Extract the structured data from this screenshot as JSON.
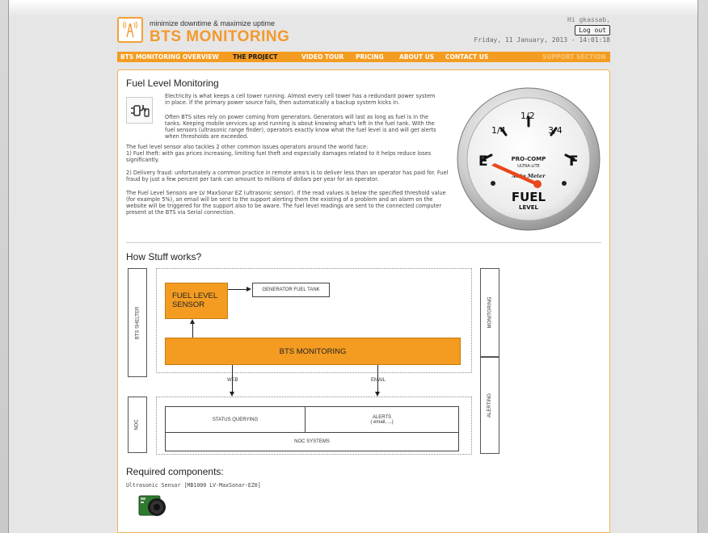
{
  "header": {
    "tagline": "minimize downtime & maximize uptime",
    "brand": "BTS MONITORING",
    "greeting": "Hi gkassab,",
    "logout_label": "Log out",
    "datetime": "Friday, 11 January, 2013 - 14:01:18"
  },
  "nav": {
    "items": [
      {
        "label": "BTS MONITORING OVERVIEW"
      },
      {
        "label": "THE PROJECT"
      },
      {
        "label": "VIDEO TOUR"
      },
      {
        "label": "PRICING"
      },
      {
        "label": "ABOUT US"
      },
      {
        "label": "CONTACT US"
      },
      {
        "label": "SUPPORT SECTION"
      }
    ]
  },
  "fuel": {
    "title": "Fuel Level Monitoring",
    "p1": "Electricity is what keeps a cell tower running. Almost every cell tower has a redundant power system in place. If the primary power source fails, then automatically a backup system kicks in.",
    "p2": "Often BTS sites rely on power coming from generators. Generators will last as long as fuel is in the tanks. Keeping mobile services up and running is about knowing what's left in the fuel tank. With the fuel sensors (ultrasonic range finder), operators exactly know what the fuel level is and will get alerts when thresholds are exceeded.",
    "p3a": "The fuel level sensor also tackles 2 other common issues operators around the world face:",
    "p3b": "1) Fuel theft: with gas prices increasing, limiting fuel theft and especially damages related to it helps reduce loses significantly.",
    "p4": "2) Delivery fraud: unfortunately a common practice in remote area's is to deliver less than an operator has paid for. Fuel fraud by just a few percent per tank can amount to millions of dollars per year for an operator.",
    "p5": "The Fuel Level Sensors are LV MaxSonar EZ (ultrasonic sensor). If the read values is below the specified threshold value (for example 5%), an email will be sent to the support alerting them the existing of a problem and an alarm on the website will be triggered for the support also to be aware. The fuel level readings are sent to the connected computer present at the BTS via Serial connection."
  },
  "gauge": {
    "label_quarter": "1/4",
    "label_half": "1/2",
    "label_threequarter": "3/4",
    "label_empty": "E",
    "label_full": "F",
    "brand1": "PRO-COMP",
    "brand2": "ULTRA-LITE",
    "brand3": "Auto Meter",
    "word1": "FUEL",
    "word2": "LEVEL",
    "needle_color": "#e8481c"
  },
  "how": {
    "title": "How Stuff works?",
    "bts_shelter": "BTS SHELTER",
    "noc": "NOC",
    "monitoring": "MONITORING",
    "alerting": "ALERTING",
    "sensor_line1": "FUEL LEVEL",
    "sensor_line2": "SENSOR",
    "generator_tank": "GENERATOR FUEL TANK",
    "bts_monitoring": "BTS MONITORING",
    "web": "WEB",
    "email": "EMAIL",
    "status_querying": "STATUS QUERYING",
    "alerts": "ALERTS",
    "alerts_sub": "( email, ...)",
    "noc_systems": "NOC SYSTEMS"
  },
  "required": {
    "title": "Required components:",
    "sensor": "Ultrasonic Sensor [MB1000 LV-MaxSonar-EZ0]"
  },
  "colors": {
    "accent": "#f39c21",
    "brand": "#f29a2e"
  }
}
